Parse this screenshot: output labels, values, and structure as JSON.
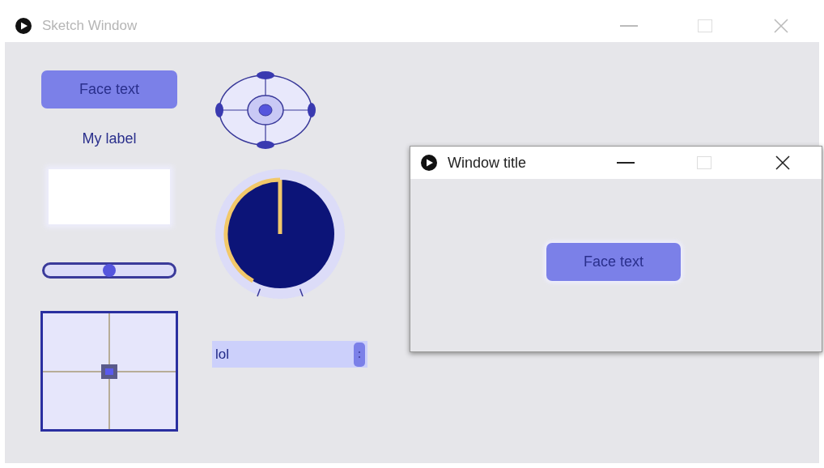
{
  "main_window": {
    "title": "Sketch Window",
    "active": false
  },
  "controls": {
    "button": "Face text",
    "label": "My label",
    "slider": {
      "level": 0.5
    },
    "knob": {
      "level": 0.5
    },
    "dropdown": {
      "value": "lol"
    }
  },
  "popup_window": {
    "title": "Window title",
    "active": true,
    "button": "Face text"
  }
}
